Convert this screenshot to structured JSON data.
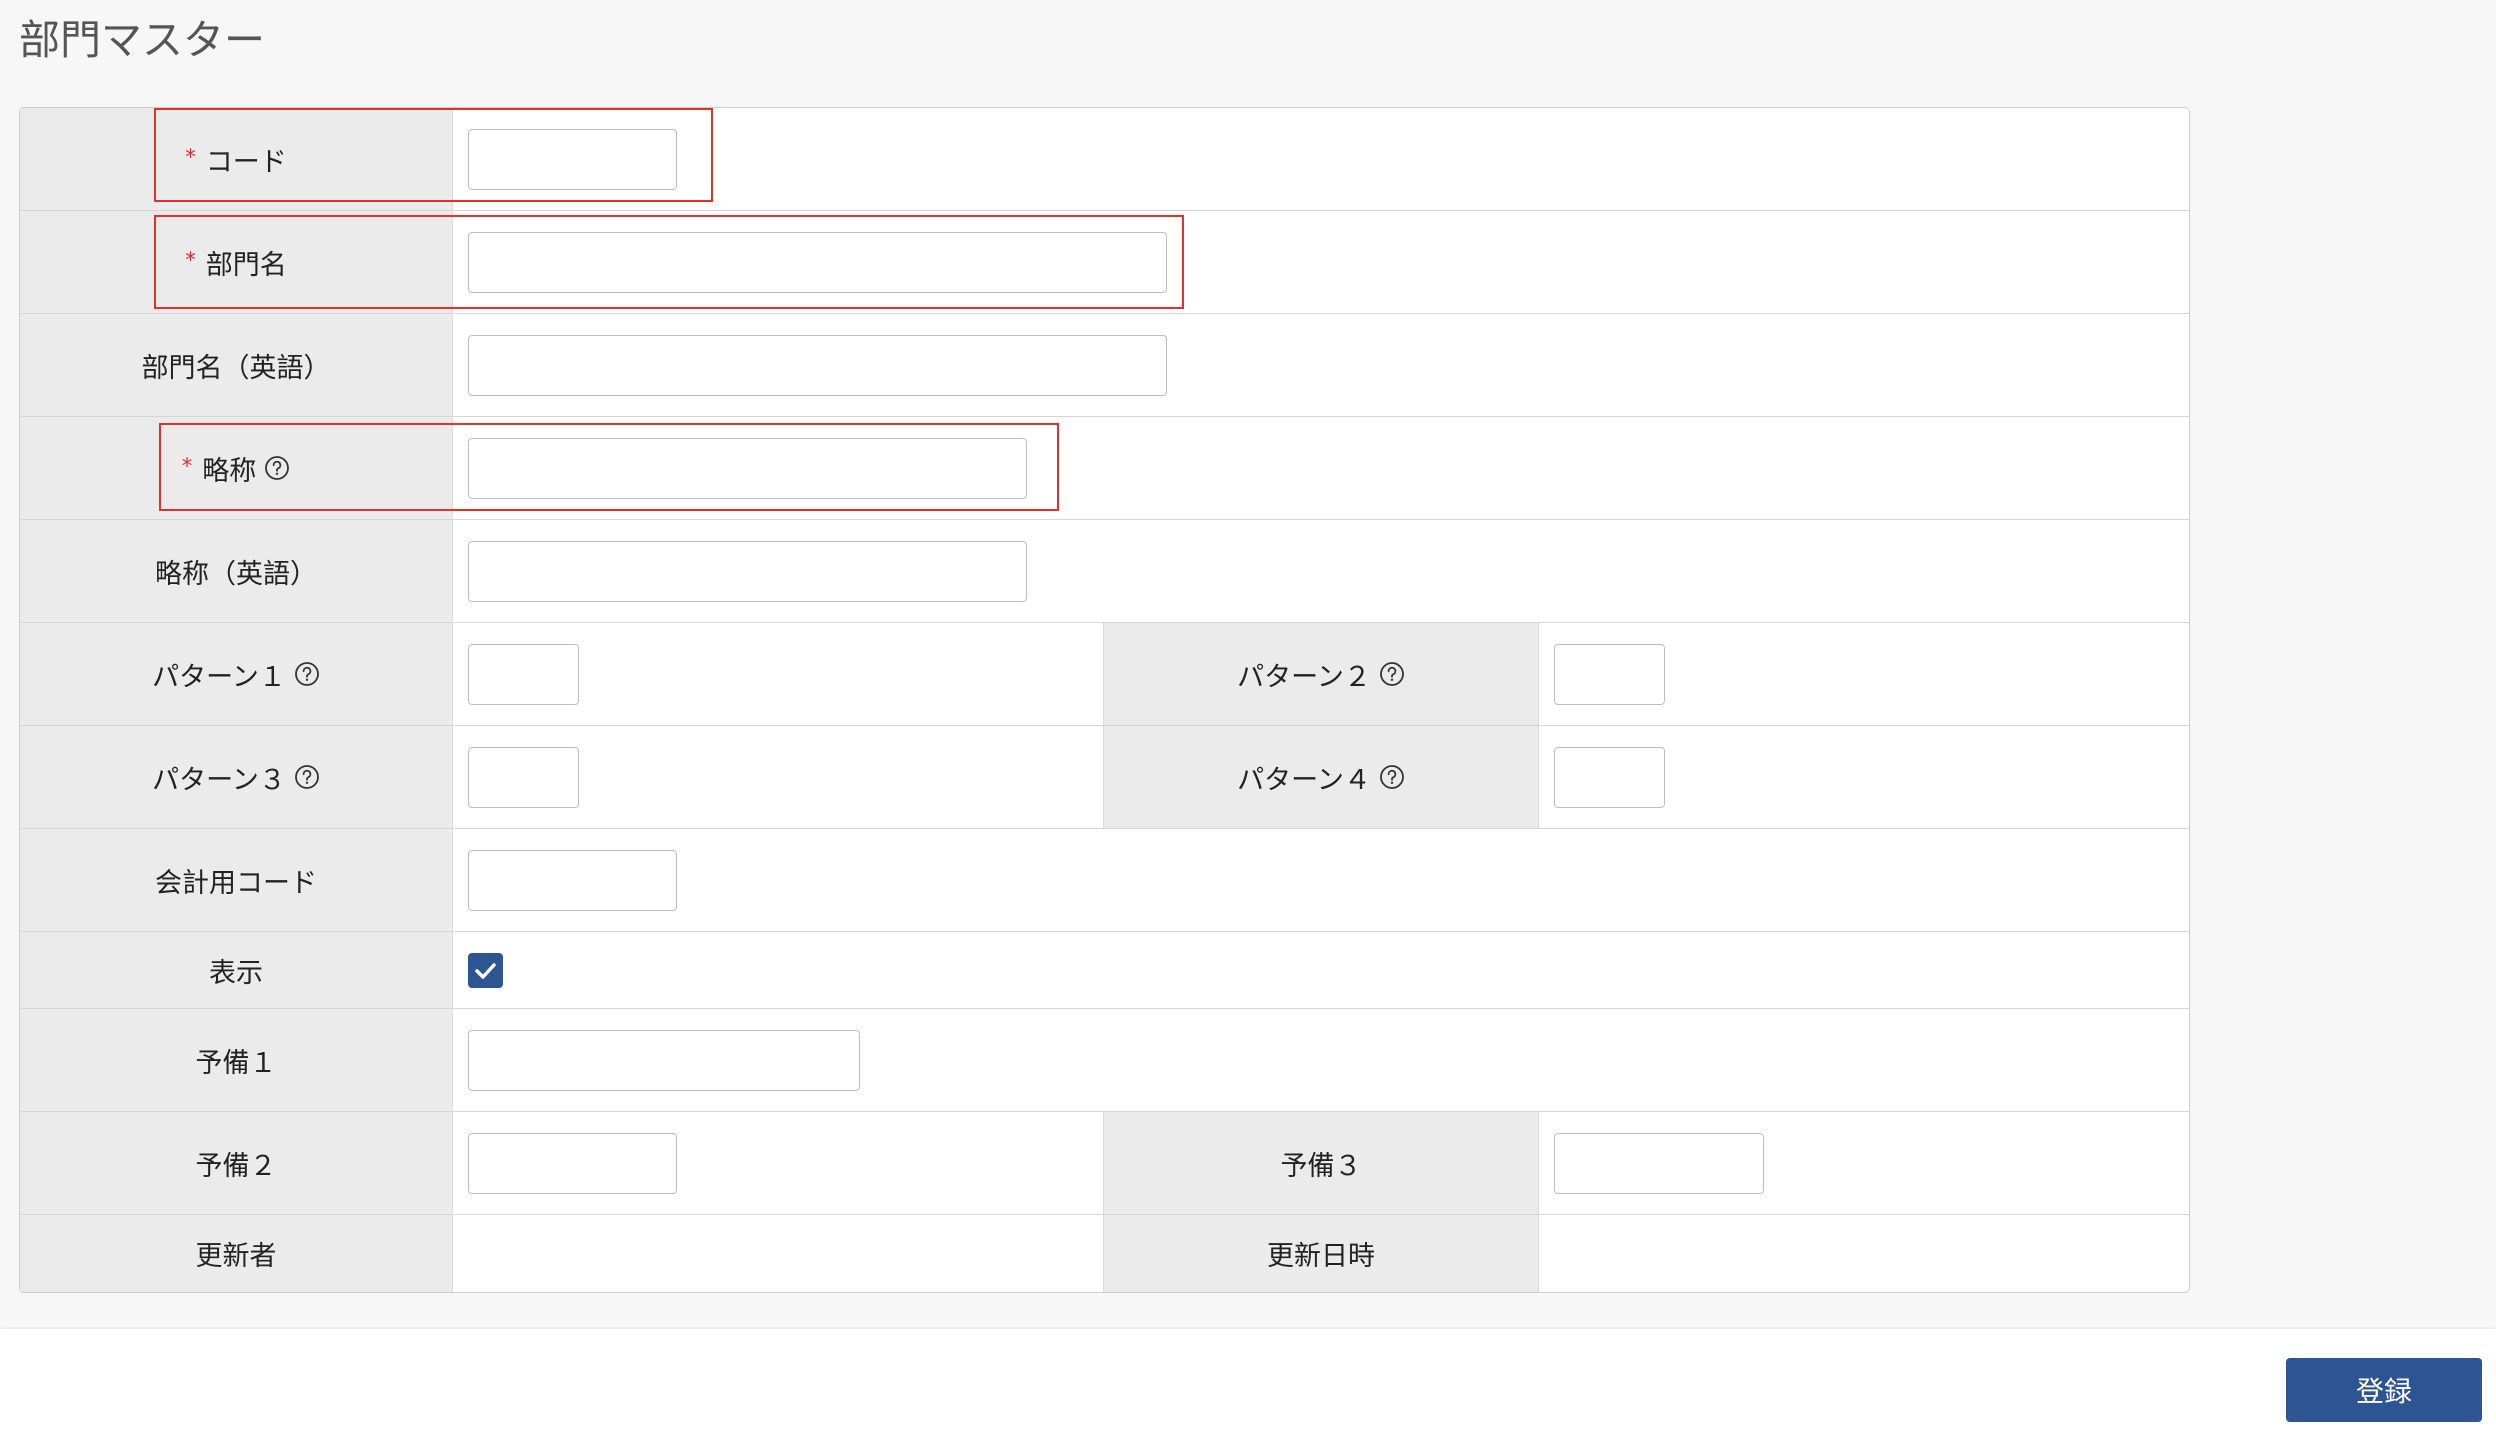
{
  "page": {
    "title": "部門マスター"
  },
  "icons": {
    "help": "question-circle-icon",
    "check": "check-icon"
  },
  "colors": {
    "required_mark": "#e02b2b",
    "annotation_box": "#e0312a",
    "primary_button": "#2c5591",
    "label_background": "#ebebeb"
  },
  "form": {
    "required_mark": "*",
    "code": {
      "label": "コード",
      "required": true,
      "value": ""
    },
    "name": {
      "label": "部門名",
      "required": true,
      "value": ""
    },
    "name_en": {
      "label": "部門名（英語）",
      "value": ""
    },
    "short_name": {
      "label": "略称",
      "required": true,
      "help": true,
      "value": ""
    },
    "short_name_en": {
      "label": "略称（英語）",
      "value": ""
    },
    "pattern1": {
      "label": "パターン１",
      "help": true,
      "value": ""
    },
    "pattern2": {
      "label": "パターン２",
      "help": true,
      "value": ""
    },
    "pattern3": {
      "label": "パターン３",
      "help": true,
      "value": ""
    },
    "pattern4": {
      "label": "パターン４",
      "help": true,
      "value": ""
    },
    "accounting_code": {
      "label": "会計用コード",
      "value": ""
    },
    "display": {
      "label": "表示",
      "checked": true
    },
    "reserve1": {
      "label": "予備１",
      "value": ""
    },
    "reserve2": {
      "label": "予備２",
      "value": ""
    },
    "reserve3": {
      "label": "予備３",
      "value": ""
    },
    "updated_by": {
      "label": "更新者",
      "value": ""
    },
    "updated_at": {
      "label": "更新日時",
      "value": ""
    }
  },
  "footer": {
    "submit_label": "登録"
  }
}
